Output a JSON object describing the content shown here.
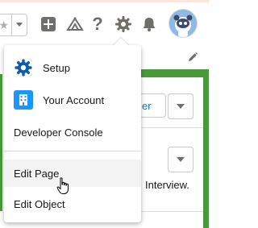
{
  "header": {
    "icons": [
      "star-icon",
      "chevron-down-icon",
      "add-icon",
      "trailhead-icon",
      "help-icon",
      "gear-icon",
      "bell-icon",
      "avatar"
    ]
  },
  "menu": {
    "items": [
      {
        "label": "Setup",
        "icon": "setup-gear-icon",
        "icon_color": "#0b5cab"
      },
      {
        "label": "Your Account",
        "icon": "building-icon",
        "icon_color": "#1b96ff"
      },
      {
        "label": "Developer Console"
      },
      {
        "label": "Edit Page"
      },
      {
        "label": "Edit Object"
      }
    ]
  },
  "background": {
    "button_text": "er",
    "trailing_text": "Interview."
  },
  "colors": {
    "accent": "#0176d3",
    "green_band": "#4a9a3a",
    "header_edge": "#fbe5dc"
  }
}
